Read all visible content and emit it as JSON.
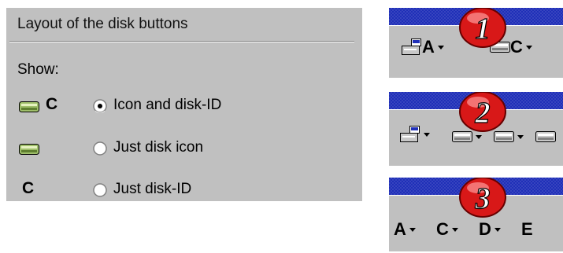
{
  "panel": {
    "title": "Layout of the disk buttons",
    "show_label": "Show:",
    "options": [
      {
        "preview_letter": "C",
        "label": "Icon and disk-ID",
        "selected": true
      },
      {
        "preview_letter": "",
        "label": "Just disk icon",
        "selected": false
      },
      {
        "preview_letter": "C",
        "label": "Just disk-ID",
        "selected": false
      }
    ]
  },
  "examples": [
    {
      "badge": "1",
      "buttons": [
        "A",
        "C"
      ]
    },
    {
      "badge": "2",
      "buttons": []
    },
    {
      "badge": "3",
      "buttons": [
        "A",
        "C",
        "D",
        "E"
      ]
    }
  ],
  "colors": {
    "panel_bg": "#c0c0c0",
    "titlebar_blue": "#1f2fb8",
    "badge_red": "#d81818"
  }
}
